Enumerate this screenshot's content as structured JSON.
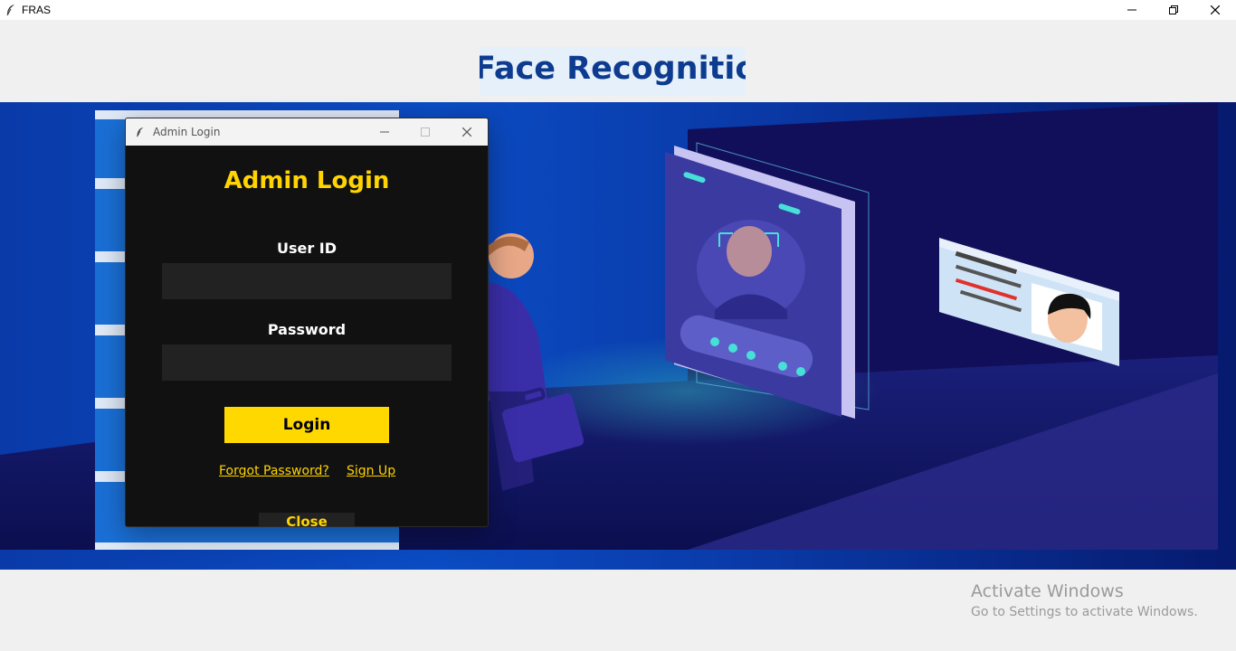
{
  "window": {
    "title": "FRAS",
    "app_icon": "feather-icon",
    "controls": [
      "minimize-icon",
      "restore-icon",
      "close-icon"
    ]
  },
  "header": {
    "heading": "Face Recognition"
  },
  "banner": {
    "icons": [
      "person-with-briefcase",
      "phone-face-scan",
      "id-card"
    ]
  },
  "dialog": {
    "title": "Admin Login",
    "heading": "Admin Login",
    "user_id_label": "User ID",
    "user_id_value": "",
    "password_label": "Password",
    "password_value": "",
    "login_label": "Login",
    "forgot_password_label": "Forgot Password?",
    "sign_up_label": "Sign Up",
    "close_label": "Close"
  },
  "watermark": {
    "title": "Activate Windows",
    "subtitle": "Go to Settings to activate Windows."
  },
  "colors": {
    "accent": "#ffd400",
    "dialog_bg": "#111111",
    "input_bg": "#222222",
    "heading_blue": "#0d3b8f",
    "banner_blue": "#0b4cc4"
  }
}
